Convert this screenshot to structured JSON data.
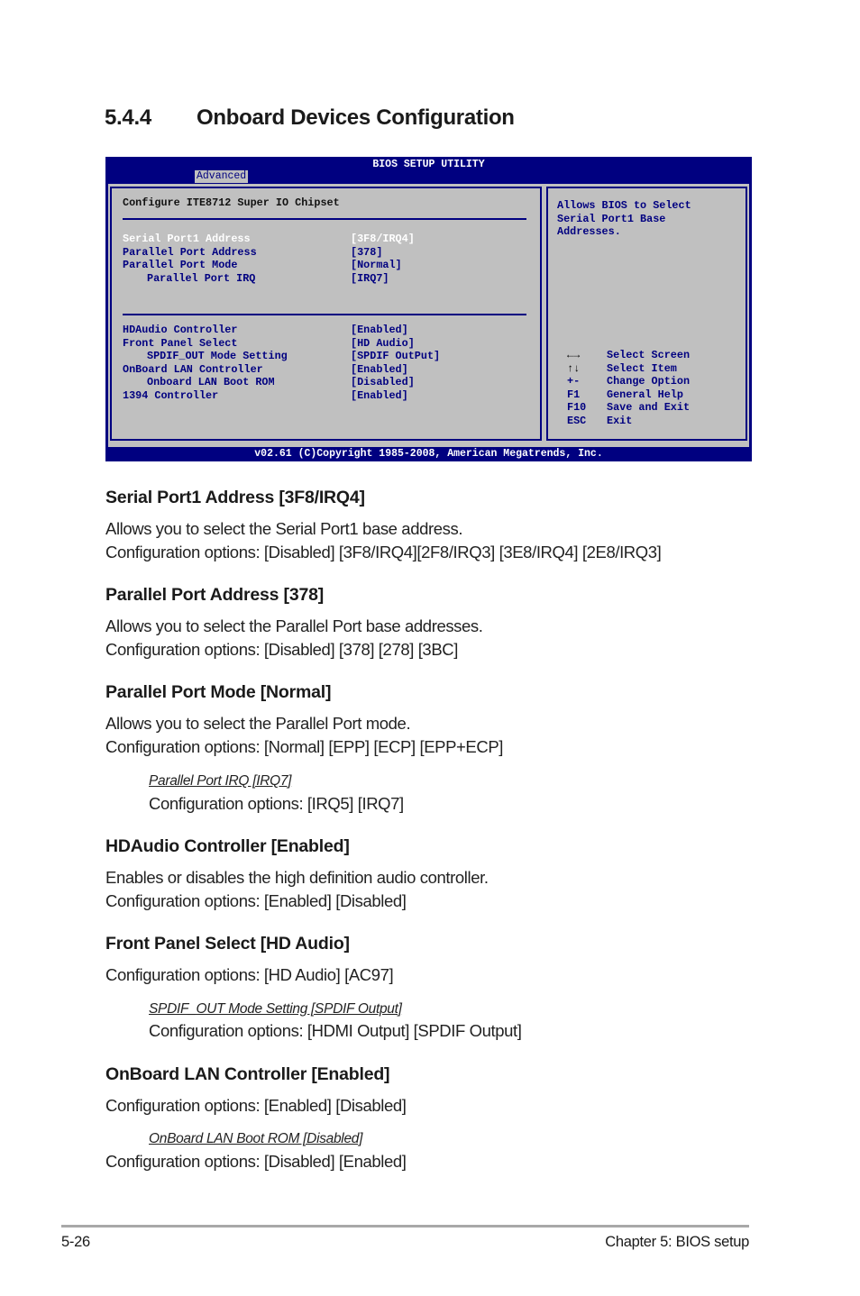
{
  "section": {
    "number": "5.4.4",
    "title": "Onboard Devices Configuration"
  },
  "bios": {
    "title": "BIOS SETUP UTILITY",
    "active_tab": "Advanced",
    "group_title": "Configure ITE8712 Super IO Chipset",
    "items_group1": [
      {
        "label": "Serial Port1 Address",
        "value": "[3F8/IRQ4]",
        "selected": true,
        "indent": false
      },
      {
        "label": "Parallel Port Address",
        "value": "[378]",
        "selected": false,
        "indent": false
      },
      {
        "label": "Parallel Port Mode",
        "value": "[Normal]",
        "selected": false,
        "indent": false
      },
      {
        "label": "Parallel Port IRQ",
        "value": "[IRQ7]",
        "selected": false,
        "indent": true
      }
    ],
    "items_group2": [
      {
        "label": "HDAudio Controller",
        "value": "[Enabled]",
        "indent": false
      },
      {
        "label": "Front Panel Select",
        "value": "[HD Audio]",
        "indent": false
      },
      {
        "label": "SPDIF_OUT Mode Setting",
        "value": "[SPDIF OutPut]",
        "indent": true
      },
      {
        "label": "OnBoard LAN Controller",
        "value": "[Enabled]",
        "indent": false
      },
      {
        "label": "Onboard LAN Boot ROM",
        "value": "[Disabled]",
        "indent": true
      },
      {
        "label": "1394 Controller",
        "value": "[Enabled]",
        "indent": false
      }
    ],
    "help_lines": [
      "Allows BIOS to Select",
      "Serial Port1 Base",
      "Addresses."
    ],
    "keys": [
      {
        "key": "←→",
        "icon": "arrow-left-right-icon",
        "action": "Select Screen"
      },
      {
        "key": "↑↓",
        "icon": "arrow-up-down-icon",
        "action": "Select Item"
      },
      {
        "key": "+-",
        "action": "Change Option"
      },
      {
        "key": "F1",
        "action": "General Help"
      },
      {
        "key": "F10",
        "action": "Save and Exit"
      },
      {
        "key": "ESC",
        "action": "Exit"
      }
    ],
    "footer": "v02.61 (C)Copyright 1985-2008, American Megatrends, Inc.",
    "colors": {
      "background": "#000080",
      "panel": "#c0c0c0",
      "text": "#000080",
      "selected": "#ffffff"
    }
  },
  "doc": {
    "serial": {
      "heading": "Serial Port1 Address [3F8/IRQ4]",
      "desc": "Allows you to select the Serial Port1 base address.",
      "options": "Configuration options: [Disabled] [3F8/IRQ4][2F8/IRQ3] [3E8/IRQ4] [2E8/IRQ3]"
    },
    "parallel_address": {
      "heading": "Parallel Port Address [378]",
      "desc": "Allows you to select the Parallel Port base addresses.",
      "options": "Configuration options: [Disabled] [378] [278] [3BC]"
    },
    "parallel_mode": {
      "heading": "Parallel Port Mode [Normal]",
      "desc": "Allows you to select the Parallel Port  mode.",
      "options": "Configuration options: [Normal] [EPP] [ECP] [EPP+ECP]"
    },
    "parallel_irq": {
      "heading": "Parallel Port IRQ [IRQ7]",
      "options": "Configuration options: [IRQ5] [IRQ7]"
    },
    "hdaudio": {
      "heading": "HDAudio Controller [Enabled]",
      "desc": "Enables or disables the high definition audio controller.",
      "options": "Configuration options: [Enabled] [Disabled]"
    },
    "front_panel": {
      "heading": "Front Panel Select [HD Audio]",
      "options": "Configuration options: [HD Audio] [AC97]"
    },
    "spdif": {
      "heading": "SPDIF_OUT Mode Setting [SPDIF Output]",
      "options": "Configuration options: [HDMI Output] [SPDIF Output]"
    },
    "lan": {
      "heading": "OnBoard LAN Controller [Enabled]",
      "options": "Configuration options: [Enabled] [Disabled]"
    },
    "lan_rom": {
      "heading": "OnBoard LAN Boot ROM [Disabled]",
      "options": "Configuration options: [Disabled] [Enabled]"
    }
  },
  "footer": {
    "page": "5-26",
    "chapter": "Chapter 5: BIOS setup"
  }
}
